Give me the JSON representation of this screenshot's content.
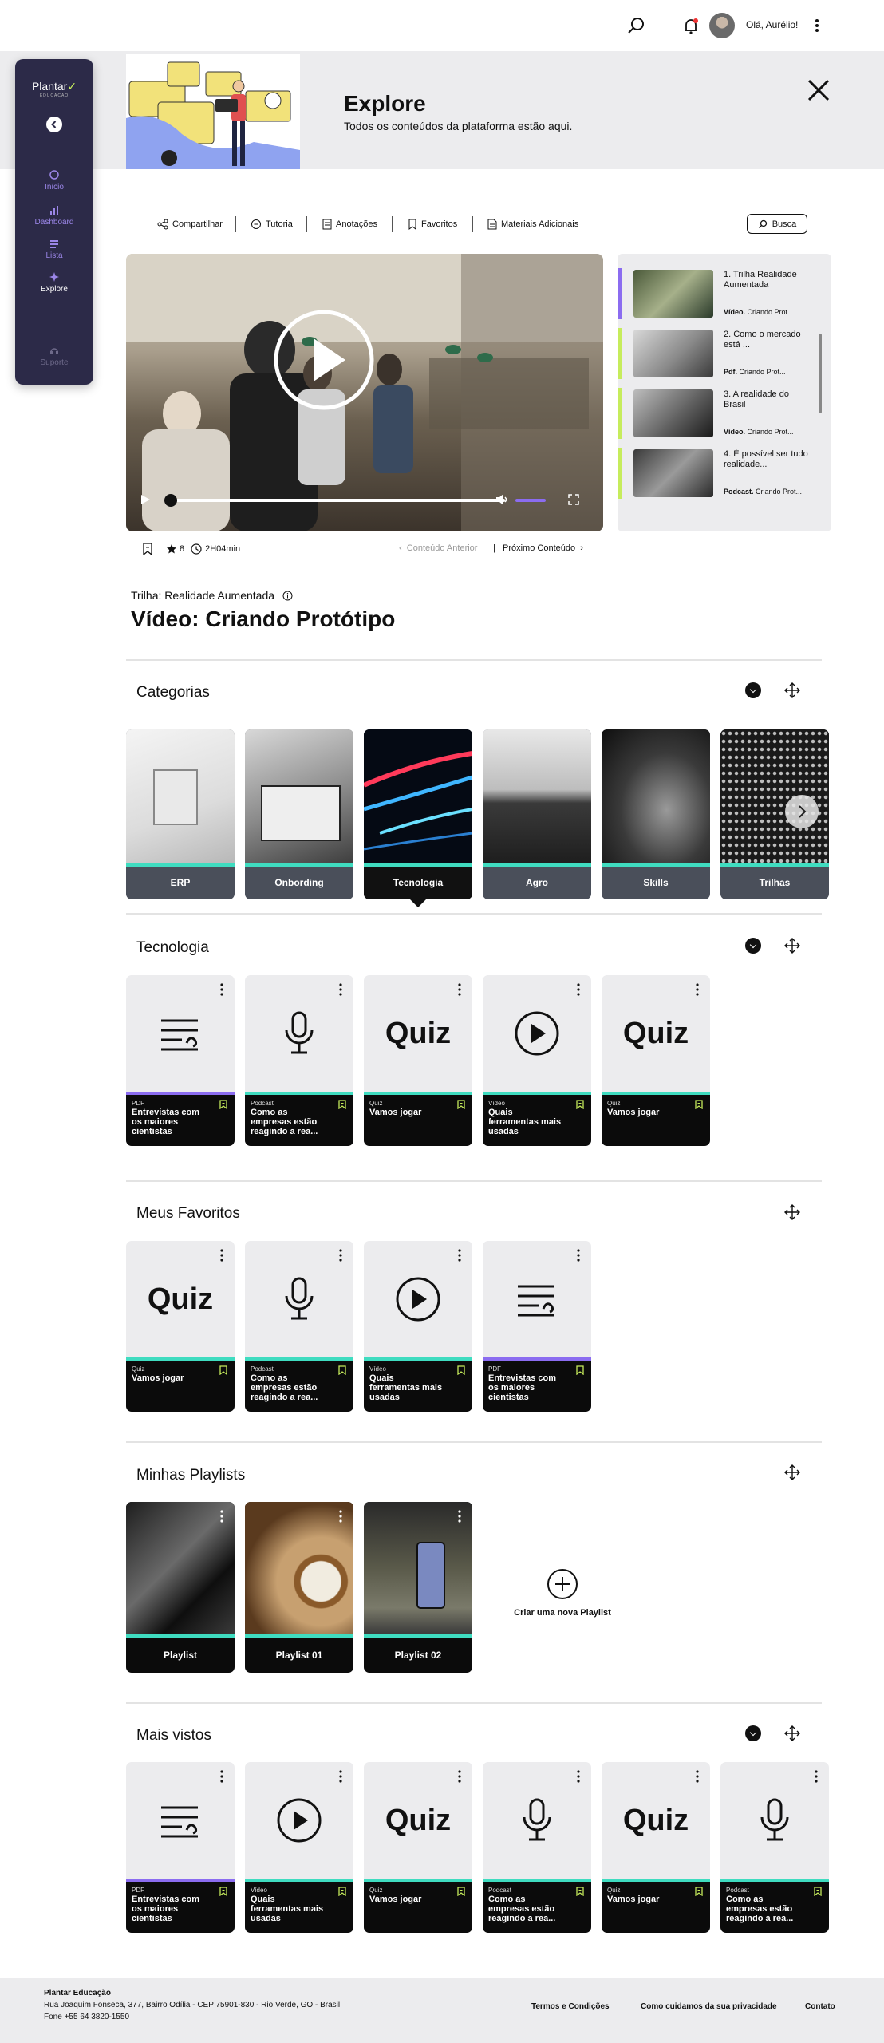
{
  "topbar": {
    "greeting": "Olá, Aurélio!"
  },
  "sidebar": {
    "brand": "Plantar",
    "brand_sub": "EDUCAÇÃO",
    "items": [
      {
        "label": "Início"
      },
      {
        "label": "Dashboard"
      },
      {
        "label": "Lista"
      },
      {
        "label": "Explore"
      },
      {
        "label": "Suporte"
      }
    ]
  },
  "banner": {
    "title": "Explore",
    "subtitle": "Todos os conteúdos da plataforma estão aqui."
  },
  "toolbar": {
    "items": [
      "Compartilhar",
      "Tutoria",
      "Anotações",
      "Favoritos",
      "Materiais Adicionais"
    ],
    "search_label": "Busca"
  },
  "playlist": [
    {
      "title": "1. Trilha Realidade Aumentada",
      "type": "Vídeo.",
      "subtitle": "Criando Prot...",
      "color": "#8b6cf0"
    },
    {
      "title": "2. Como o mercado está ...",
      "type": "Pdf.",
      "subtitle": "Criando Prot...",
      "color": "#c6ec5c"
    },
    {
      "title": "3. A realidade do Brasil",
      "type": "Vídeo.",
      "subtitle": "Criando Prot...",
      "color": "#c6ec5c"
    },
    {
      "title": "4. É possível ser tudo realidade...",
      "type": "Podcast.",
      "subtitle": "Criando Prot...",
      "color": "#c6ec5c"
    }
  ],
  "video_meta": {
    "rating": "8",
    "duration": "2H04min",
    "prev": "Conteúdo Anterior",
    "separator": "|",
    "next": "Próximo Conteúdo",
    "trail": "Trilha: Realidade Aumentada",
    "title": "Vídeo: Criando Protótipo"
  },
  "categories": {
    "title": "Categorias",
    "items": [
      "ERP",
      "Onbording",
      "Tecnologia",
      "Agro",
      "Skills",
      "Trilhas"
    ],
    "active": "Tecnologia"
  },
  "tecnologia": {
    "title": "Tecnologia",
    "cards": [
      {
        "kind": "pdf",
        "type": "PDF",
        "name": "Entrevistas com os maiores cientistas"
      },
      {
        "kind": "podcast",
        "type": "Podcast",
        "name": "Como as empresas estão reagindo a rea..."
      },
      {
        "kind": "quiz",
        "type": "Quiz",
        "name": "Vamos jogar",
        "quiz_label": "Quiz"
      },
      {
        "kind": "video",
        "type": "Vídeo",
        "name": "Quais ferramentas mais usadas"
      },
      {
        "kind": "quiz",
        "type": "Quiz",
        "name": "Vamos jogar",
        "quiz_label": "Quiz"
      }
    ]
  },
  "favoritos": {
    "title": "Meus Favoritos",
    "cards": [
      {
        "kind": "quiz",
        "type": "Quiz",
        "name": "Vamos jogar",
        "quiz_label": "Quiz"
      },
      {
        "kind": "podcast",
        "type": "Podcast",
        "name": "Como as empresas estão reagindo a rea..."
      },
      {
        "kind": "video",
        "type": "Vídeo",
        "name": "Quais ferramentas mais usadas"
      },
      {
        "kind": "pdf",
        "type": "PDF",
        "name": "Entrevistas com os maiores cientistas"
      }
    ]
  },
  "playlists": {
    "title": "Minhas Playlists",
    "items": [
      "Playlist",
      "Playlist 01",
      "Playlist 02"
    ],
    "new_label": "Criar uma nova Playlist"
  },
  "mais_vistos": {
    "title": "Mais vistos",
    "cards": [
      {
        "kind": "pdf",
        "type": "PDF",
        "name": "Entrevistas com os maiores cientistas"
      },
      {
        "kind": "video",
        "type": "Vídeo",
        "name": "Quais ferramentas mais usadas"
      },
      {
        "kind": "quiz",
        "type": "Quiz",
        "name": "Vamos jogar",
        "quiz_label": "Quiz"
      },
      {
        "kind": "podcast",
        "type": "Podcast",
        "name": "Como as empresas estão reagindo a rea..."
      },
      {
        "kind": "quiz",
        "type": "Quiz",
        "name": "Vamos jogar",
        "quiz_label": "Quiz"
      },
      {
        "kind": "podcast",
        "type": "Podcast",
        "name": "Como as empresas estão reagindo a rea..."
      }
    ]
  },
  "footer": {
    "company": "Plantar Educação",
    "address": "Rua Joaquim Fonseca, 377, Bairro Odília - CEP 75901-830 - Rio Verde, GO - Brasil",
    "phone": "Fone +55 64 3820-1550",
    "links": [
      "Termos e Condições",
      "Como cuidamos da sua privacidade",
      "Contato"
    ]
  },
  "colors": {
    "accent_purple": "#8b6cf0",
    "accent_teal": "#3fdcc0",
    "accent_lime": "#c6ec5c",
    "sidebar_bg": "#2c2a48"
  }
}
